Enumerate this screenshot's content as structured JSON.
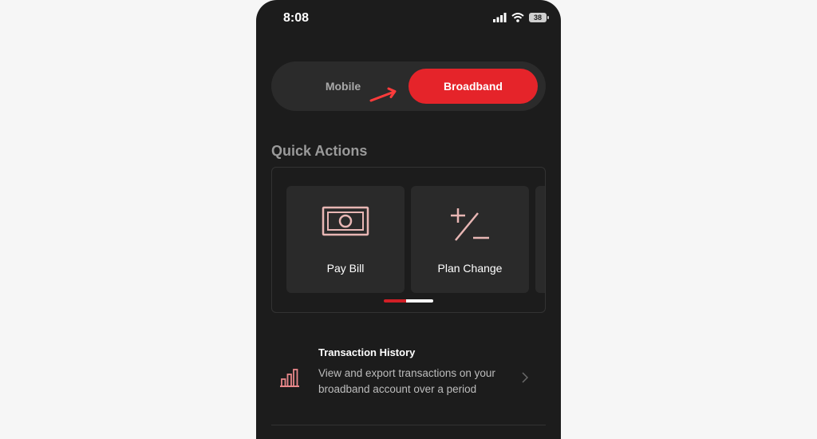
{
  "status_bar": {
    "time": "8:08",
    "battery": "38"
  },
  "service_toggle": {
    "options": [
      "Mobile",
      "Broadband"
    ],
    "selected": "Broadband"
  },
  "quick_actions": {
    "title": "Quick Actions",
    "cards": [
      {
        "label": "Pay Bill",
        "icon": "cash-icon"
      },
      {
        "label": "Plan Change",
        "icon": "plus-minus-icon"
      }
    ]
  },
  "transaction_history": {
    "title": "Transaction History",
    "description": "View and export transactions on your broadband account over a period",
    "icon": "bar-chart-icon"
  },
  "colors": {
    "accent": "#e5242a",
    "background": "#1c1c1c",
    "card": "#2a2a2a",
    "icon_tint": "#e8b6b4"
  }
}
